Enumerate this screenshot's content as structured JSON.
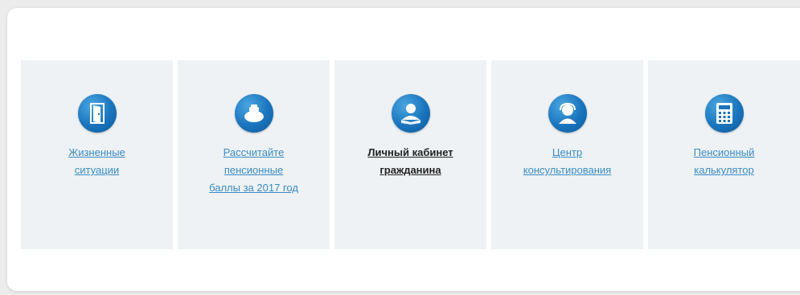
{
  "colors": {
    "link": "#3a8bc8",
    "active_link": "#222222",
    "icon_blue": "#1a74bd",
    "tile_bg": "#eef2f4"
  },
  "tiles": [
    {
      "label": "Жизненные\nситуации",
      "icon": "door-icon"
    },
    {
      "label": "Рассчитайте\nпенсионные\nбаллы за 2017 год",
      "icon": "piggy-bank-icon"
    },
    {
      "label": "Личный кабинет\nгражданина",
      "icon": "user-book-icon"
    },
    {
      "label": "Центр\nконсультирования",
      "icon": "consultant-icon"
    },
    {
      "label": "Пенсионный\nкалькулятор",
      "icon": "calculator-icon"
    }
  ]
}
